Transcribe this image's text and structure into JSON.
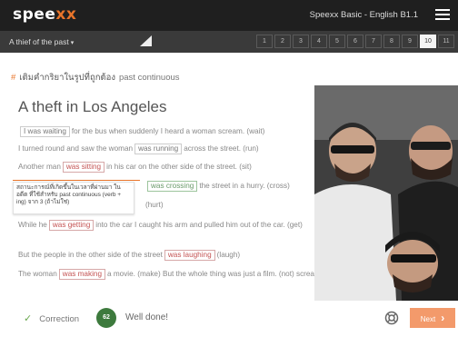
{
  "brand": {
    "logo_main": "spee",
    "logo_accent": "xx",
    "accent_color": "#e8742a"
  },
  "header": {
    "course_title": "Speexx Basic - English B1.1",
    "menu_icon": "hamburger-menu-icon"
  },
  "navbar": {
    "lesson_title": "A thief of the past",
    "caret": "▾",
    "pages": [
      "1",
      "2",
      "3",
      "4",
      "5",
      "6",
      "7",
      "8",
      "9",
      "10",
      "11"
    ],
    "active_page": "10"
  },
  "breadcrumb": {
    "thai": "เติมคำกริยาในรูปที่ถูกต้อง",
    "english": "past continuous"
  },
  "exercise": {
    "title": "A theft in Los Angeles",
    "s1": {
      "blank": "I was waiting",
      "rest": "for the bus when suddenly I heard a woman scream. (wait)"
    },
    "s2": {
      "pre": "I turned round and saw the woman",
      "blank": "was running",
      "rest": "across the street. (run)"
    },
    "s3": {
      "pre": "Another man",
      "blank": "was sitting",
      "rest": "in his car on the other side of the street. (sit)"
    },
    "s4": {
      "pre": "",
      "blank": "was crossing",
      "rest": "the street in a hurry. (cross)"
    },
    "s4_tail": "(hurt)",
    "tooltip": "สถานะการณ์ที่เกิดขึ้นในเวลาที่ผ่านมา ในอดีต ที่ใช้สำหรับ past continuous (verb + ing) จาก 3 (ถ้าไม่ใช่)",
    "s5": {
      "pre": "While he",
      "blank": "was getting",
      "rest": "into the car I caught his arm and pulled him out of the car. (get)"
    },
    "s6": {
      "pre": "But the people in the other side of the street",
      "blank": "was laughing",
      "rest": "(laugh)"
    },
    "s7": {
      "pre": "The woman",
      "blank": "was making",
      "rest": "a movie. (make) But the whole thing was just a film. (not) scream."
    }
  },
  "footer": {
    "correction_label": "Correction",
    "score": "62",
    "feedback": "Well done!",
    "next_label": "Next"
  }
}
